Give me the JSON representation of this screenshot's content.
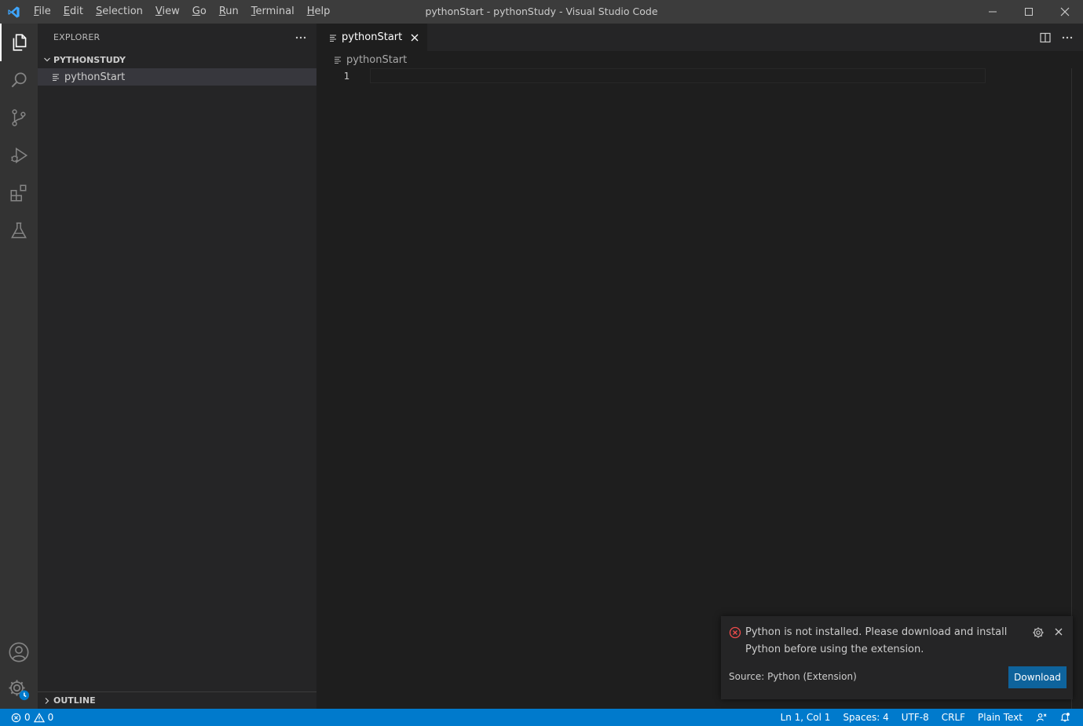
{
  "window": {
    "title": "pythonStart - pythonStudy - Visual Studio Code"
  },
  "menu": [
    {
      "pre": "",
      "u": "F",
      "rest": "ile"
    },
    {
      "pre": "",
      "u": "E",
      "rest": "dit"
    },
    {
      "pre": "",
      "u": "S",
      "rest": "election"
    },
    {
      "pre": "",
      "u": "V",
      "rest": "iew"
    },
    {
      "pre": "",
      "u": "G",
      "rest": "o"
    },
    {
      "pre": "",
      "u": "R",
      "rest": "un"
    },
    {
      "pre": "",
      "u": "T",
      "rest": "erminal"
    },
    {
      "pre": "",
      "u": "H",
      "rest": "elp"
    }
  ],
  "sidebar": {
    "title": "EXPLORER",
    "folder": "PYTHONSTUDY",
    "files": [
      "pythonStart"
    ],
    "outline": "OUTLINE"
  },
  "editor": {
    "tab_label": "pythonStart",
    "breadcrumb": "pythonStart",
    "line_number": "1"
  },
  "notification": {
    "message": "Python is not installed. Please download and install Python before using the extension.",
    "source": "Source: Python (Extension)",
    "button": "Download"
  },
  "status": {
    "errors": "0",
    "warnings": "0",
    "position": "Ln 1, Col 1",
    "spaces": "Spaces: 4",
    "encoding": "UTF-8",
    "eol": "CRLF",
    "language": "Plain Text"
  },
  "colors": {
    "accent": "#007acc",
    "error": "#f14c4c",
    "button": "#0e639c"
  }
}
